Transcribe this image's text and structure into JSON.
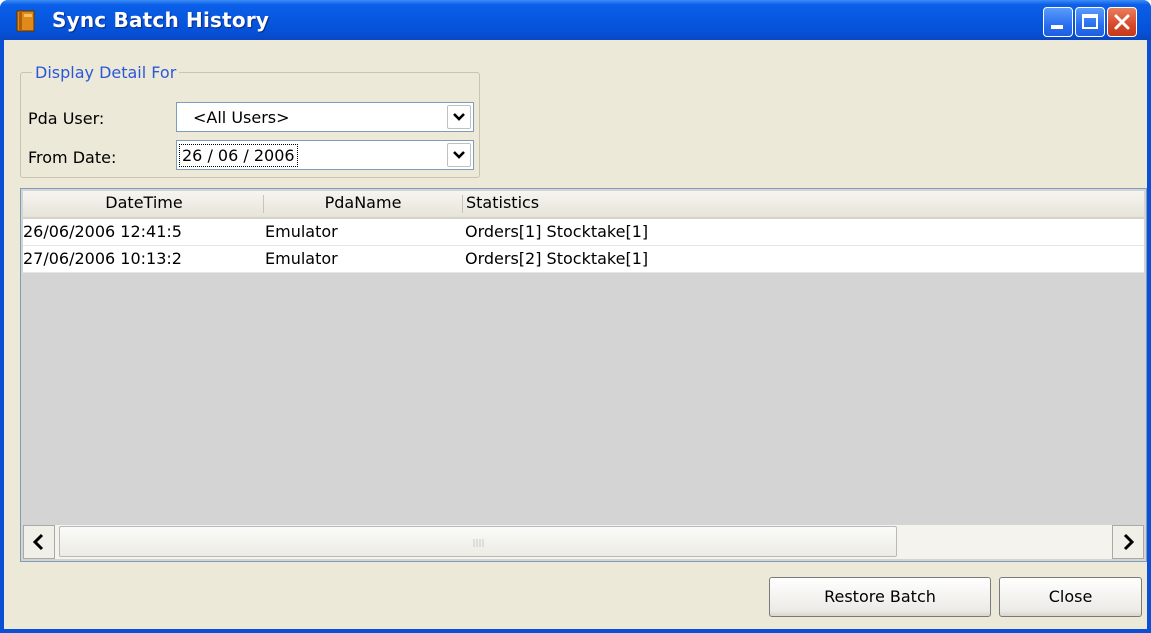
{
  "window": {
    "title": "Sync Batch History",
    "icon": "book-icon",
    "controls": [
      "minimize-icon",
      "maximize-icon",
      "close-icon"
    ]
  },
  "filter": {
    "legend": "Display Detail For",
    "pda_user_label": "Pda User:",
    "pda_user_value": "<All Users>",
    "from_date_label": "From Date:",
    "from_date_value": "26 / 06 / 2006"
  },
  "grid": {
    "columns": [
      "DateTime",
      "PdaName",
      "Statistics"
    ],
    "rows": [
      [
        "26/06/2006 12:41:5",
        "Emulator",
        "Orders[1] Stocktake[1]"
      ],
      [
        "27/06/2006 10:13:2",
        "Emulator",
        "Orders[2] Stocktake[1]"
      ]
    ]
  },
  "buttons": {
    "restore": "Restore Batch",
    "close": "Close"
  },
  "colors": {
    "titlebar": "#0858e0",
    "window_bg": "#ece9d8",
    "legend_text": "#2a58d8",
    "grid_empty": "#d4d4d4"
  }
}
